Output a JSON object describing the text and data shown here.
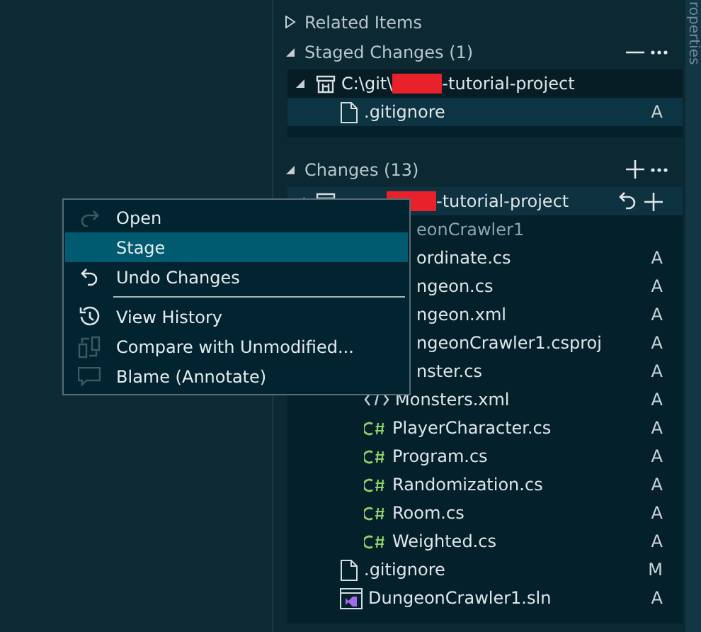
{
  "side_tab": {
    "label": "roperties"
  },
  "sections": [
    {
      "kind": "related",
      "title": "Related Items",
      "expanded": false
    },
    {
      "kind": "staged",
      "title": "Staged Changes (1)",
      "expanded": true,
      "tree": [
        {
          "kind": "repo",
          "path_start": "C:\\git\\",
          "path_end": "-tutorial-project",
          "expanded": true,
          "selected": false,
          "children": [
            {
              "kind": "file",
              "name": ".gitignore",
              "status": "A",
              "selected": true
            }
          ]
        }
      ]
    },
    {
      "kind": "changes",
      "title": "Changes (13)",
      "expanded": true,
      "tree": [
        {
          "kind": "repo",
          "path_end": "-tutorial-project",
          "expanded": true,
          "selected": true,
          "children": [
            {
              "kind": "project",
              "name": "eonCrawler1",
              "obscured": true,
              "selected": false,
              "children": [
                {
                  "name": "ordinate.cs",
                  "status": "A",
                  "obscured": true,
                  "selected": false
                },
                {
                  "name": "ngeon.cs",
                  "status": "A",
                  "obscured": true,
                  "selected": false
                },
                {
                  "name": "ngeon.xml",
                  "status": "A",
                  "obscured": true,
                  "selected": false
                },
                {
                  "name": "ngeonCrawler1.csproj",
                  "status": "A",
                  "obscured": true,
                  "selected": false
                },
                {
                  "name": "nster.cs",
                  "status": "A",
                  "obscured": true,
                  "selected": false
                },
                {
                  "kind": "xml",
                  "name": "Monsters.xml",
                  "status": "A",
                  "selected": false
                },
                {
                  "kind": "csharp",
                  "name": "PlayerCharacter.cs",
                  "status": "A",
                  "selected": false
                },
                {
                  "kind": "csharp",
                  "name": "Program.cs",
                  "status": "A",
                  "selected": false
                },
                {
                  "kind": "csharp",
                  "name": "Randomization.cs",
                  "status": "A",
                  "selected": false
                },
                {
                  "kind": "csharp",
                  "name": "Room.cs",
                  "status": "A",
                  "selected": false
                },
                {
                  "kind": "csharp",
                  "name": "Weighted.cs",
                  "status": "A",
                  "selected": false
                }
              ]
            },
            {
              "kind": "file",
              "name": ".gitignore",
              "status": "M",
              "selected": false
            },
            {
              "kind": "solution",
              "name": "DungeonCrawler1.sln",
              "status": "A",
              "selected": false
            }
          ]
        }
      ]
    }
  ],
  "context_menu": [
    {
      "kind": "open",
      "label": "Open",
      "selected": false
    },
    {
      "kind": "stage",
      "label": "Stage",
      "selected": true
    },
    {
      "kind": "undo",
      "label": "Undo Changes",
      "selected": false
    },
    {
      "kind": "separator"
    },
    {
      "kind": "history",
      "label": "View History",
      "selected": false
    },
    {
      "kind": "compare",
      "label": "Compare with Unmodified...",
      "selected": false
    },
    {
      "kind": "blame",
      "label": "Blame (Annotate)",
      "selected": false
    }
  ]
}
